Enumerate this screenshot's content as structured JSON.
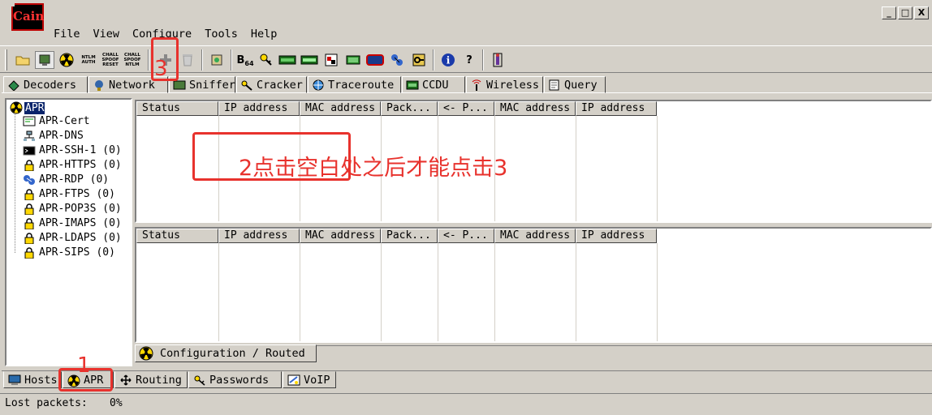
{
  "app": {
    "logo_text": "Cain",
    "window_controls": {
      "minimize": "_",
      "maximize": "□",
      "close": "X"
    }
  },
  "menu": [
    "File",
    "View",
    "Configure",
    "Tools",
    "Help"
  ],
  "toolbar": {
    "auth_labels": [
      [
        "NTLM",
        "AUTH"
      ],
      [
        "CHALL",
        "SPOOF",
        "RESET"
      ],
      [
        "CHALL",
        "SPOOF",
        "NTLM"
      ]
    ],
    "b64_label": "B",
    "b64_sub": "64",
    "help_glyph": "?",
    "info_glyph": "i"
  },
  "top_tabs": [
    "Decoders",
    "Network",
    "Sniffer",
    "Cracker",
    "Traceroute",
    "CCDU",
    "Wireless",
    "Query"
  ],
  "tree": {
    "root": "APR",
    "items": [
      "APR-Cert",
      "APR-DNS",
      "APR-SSH-1 (0)",
      "APR-HTTPS (0)",
      "APR-RDP (0)",
      "APR-FTPS (0)",
      "APR-POP3S (0)",
      "APR-IMAPS (0)",
      "APR-LDAPS (0)",
      "APR-SIPS (0)"
    ]
  },
  "upper_table": {
    "columns": [
      "Status",
      "IP address",
      "MAC address",
      "Pack...",
      "<- P...",
      "MAC address",
      "IP address"
    ]
  },
  "lower_table": {
    "columns": [
      "Status",
      "IP address",
      "MAC address",
      "Pack...",
      "<- P...",
      "MAC address",
      "IP address"
    ]
  },
  "mid_tab": "Configuration / Routed",
  "bottom_tabs": [
    "Hosts",
    "APR",
    "Routing",
    "Passwords",
    "VoIP"
  ],
  "status": {
    "label": "Lost packets:",
    "value": "0%"
  },
  "annotations": {
    "step1": "1",
    "step3": "3",
    "note": "2点击空白处之后才能点击3"
  },
  "colors": {
    "annotation": "#e8322d",
    "window_bg": "#d4d0c8",
    "selection": "#0a246a"
  }
}
